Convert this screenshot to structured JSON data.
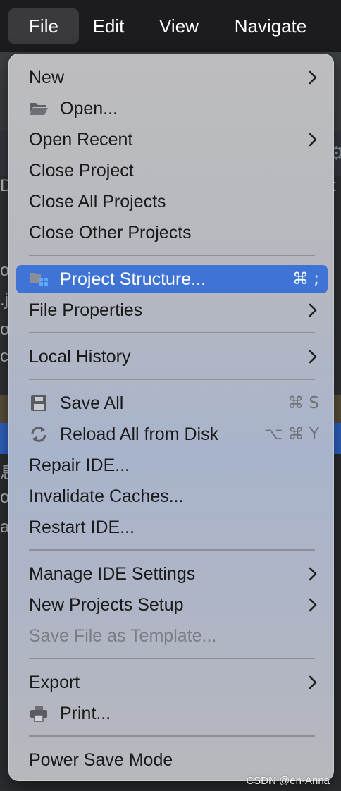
{
  "menubar": {
    "items": [
      {
        "label": "File",
        "active": true
      },
      {
        "label": "Edit"
      },
      {
        "label": "View"
      },
      {
        "label": "Navigate"
      }
    ]
  },
  "background_fragments": [
    "D",
    "t",
    "or",
    ".j",
    "o",
    "c",
    "息",
    "or",
    "ar"
  ],
  "menu": {
    "items": [
      {
        "label": "New",
        "submenu": true
      },
      {
        "label": "Open...",
        "icon": "folder-open-icon"
      },
      {
        "label": "Open Recent",
        "submenu": true
      },
      {
        "label": "Close Project"
      },
      {
        "label": "Close All Projects"
      },
      {
        "label": "Close Other Projects"
      },
      {
        "label": "Project Structure...",
        "icon": "project-structure-icon",
        "shortcut": "⌘ ;",
        "highlighted": true
      },
      {
        "label": "File Properties",
        "submenu": true
      },
      {
        "label": "Local History",
        "submenu": true
      },
      {
        "label": "Save All",
        "icon": "save-icon",
        "shortcut": "⌘ S"
      },
      {
        "label": "Reload All from Disk",
        "icon": "reload-icon",
        "shortcut": "⌥ ⌘ Y"
      },
      {
        "label": "Repair IDE..."
      },
      {
        "label": "Invalidate Caches..."
      },
      {
        "label": "Restart IDE..."
      },
      {
        "label": "Manage IDE Settings",
        "submenu": true
      },
      {
        "label": "New Projects Setup",
        "submenu": true
      },
      {
        "label": "Save File as Template...",
        "disabled": true
      },
      {
        "label": "Export",
        "submenu": true
      },
      {
        "label": "Print...",
        "icon": "print-icon"
      },
      {
        "label": "Power Save Mode"
      }
    ]
  },
  "watermark": "CSDN @en-Anna",
  "colors": {
    "menubar_bg": "#1c1c1e",
    "highlight": "#3f74d6",
    "menu_text": "#1a1a1a",
    "disabled_text": "#7c7e84"
  }
}
